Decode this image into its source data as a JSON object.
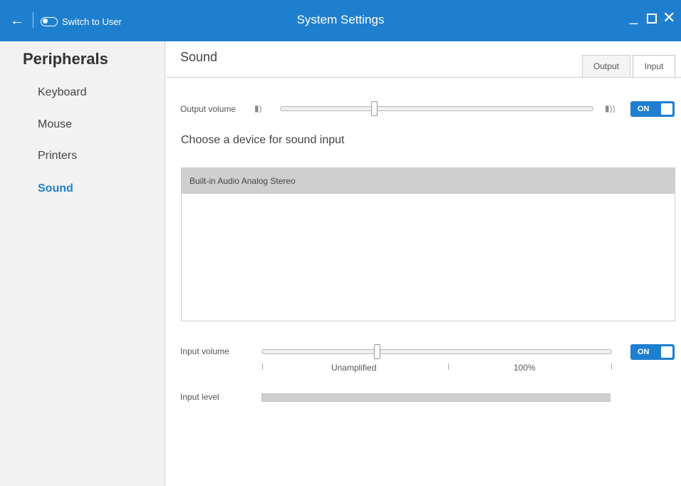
{
  "titlebar": {
    "title": "System Settings",
    "switch_label": "Switch to User",
    "back_icon": "arrow-left-icon",
    "minimize_glyph": "_",
    "close_glyph": "✕"
  },
  "sidebar": {
    "heading": "Peripherals",
    "items": [
      {
        "label": "Keyboard",
        "active": false
      },
      {
        "label": "Mouse",
        "active": false
      },
      {
        "label": "Printers",
        "active": false
      },
      {
        "label": "Sound",
        "active": true
      }
    ]
  },
  "main": {
    "title": "Sound",
    "tabs": [
      {
        "label": "Output",
        "selected": false
      },
      {
        "label": "Input",
        "selected": true
      }
    ],
    "output_volume": {
      "label": "Output volume",
      "value_fraction": 0.3,
      "toggle": "ON"
    },
    "device_section_title": "Choose a device for sound input",
    "devices": [
      "Built-in Audio Analog Stereo"
    ],
    "input_volume": {
      "label": "Input volume",
      "value_fraction": 0.33,
      "toggle": "ON",
      "marks": [
        "Unamplified",
        "100%"
      ]
    },
    "input_level": {
      "label": "Input level"
    }
  },
  "colors": {
    "accent": "#1f7fcf",
    "sidebar_bg": "#f2f2f2",
    "selected_row": "#cfcfcf"
  }
}
